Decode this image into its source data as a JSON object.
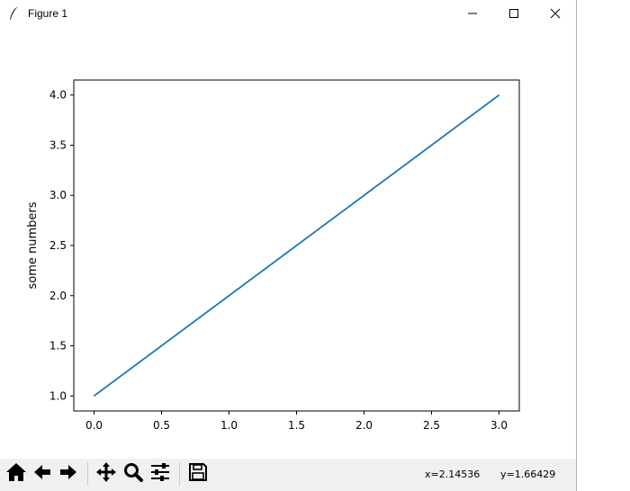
{
  "window": {
    "title": "Figure 1"
  },
  "icons": {
    "app": "feather-icon",
    "minimize": "minimize-icon",
    "maximize": "maximize-icon",
    "close": "close-icon"
  },
  "toolbar": {
    "buttons": [
      {
        "name": "home",
        "icon": "home-icon"
      },
      {
        "name": "back",
        "icon": "arrow-left-icon"
      },
      {
        "name": "forward",
        "icon": "arrow-right-icon"
      },
      {
        "name": "pan",
        "icon": "move-icon"
      },
      {
        "name": "zoom",
        "icon": "magnifier-icon"
      },
      {
        "name": "configure-subplots",
        "icon": "sliders-icon"
      },
      {
        "name": "save",
        "icon": "floppy-disk-icon"
      }
    ],
    "x_readout": "x=2.14536",
    "y_readout": "y=1.66429"
  },
  "chart_data": {
    "type": "line",
    "title": "",
    "xlabel": "",
    "ylabel": "some numbers",
    "x": [
      0,
      1,
      2,
      3
    ],
    "series": [
      {
        "values": [
          1,
          2,
          3,
          4
        ],
        "color": "#1f77b4"
      }
    ],
    "xlim": [
      -0.15,
      3.15
    ],
    "ylim": [
      0.85,
      4.15
    ],
    "xticks": [
      "0.0",
      "0.5",
      "1.0",
      "1.5",
      "2.0",
      "2.5",
      "3.0"
    ],
    "yticks": [
      "1.0",
      "1.5",
      "2.0",
      "2.5",
      "3.0",
      "3.5",
      "4.0"
    ],
    "grid": false
  }
}
